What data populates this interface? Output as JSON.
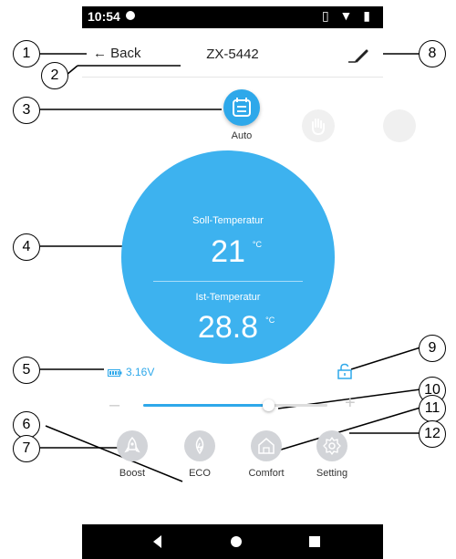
{
  "status_bar": {
    "time": "10:54",
    "icons": "▯ ▼ ▮"
  },
  "header": {
    "back_label": "← Back",
    "device_name": "ZX-5442"
  },
  "modes": [
    {
      "label": "Auto",
      "active": true
    }
  ],
  "temperature": {
    "target_label": "Soll-Temperatur",
    "target_value": "21",
    "target_unit": "°C",
    "current_label": "Ist-Temperatur",
    "current_value": "28.8",
    "current_unit": "°C"
  },
  "battery": {
    "icon": "battery-icon",
    "voltage": "3.16V"
  },
  "slider": {
    "minus": "–",
    "plus": "+",
    "level": 0.68
  },
  "bottom_buttons": [
    {
      "label": "Boost",
      "icon": "rocket-icon"
    },
    {
      "label": "ECO",
      "icon": "leaf-icon"
    },
    {
      "label": "Comfort",
      "icon": "home-icon"
    },
    {
      "label": "Setting",
      "icon": "gear-icon"
    }
  ],
  "callouts": [
    "1",
    "2",
    "3",
    "4",
    "5",
    "6",
    "7",
    "8",
    "9",
    "10",
    "11",
    "12"
  ],
  "colors": {
    "accent": "#2ea8ea",
    "circle": "#3db2ef",
    "button_gray": "#d2d4d8"
  }
}
